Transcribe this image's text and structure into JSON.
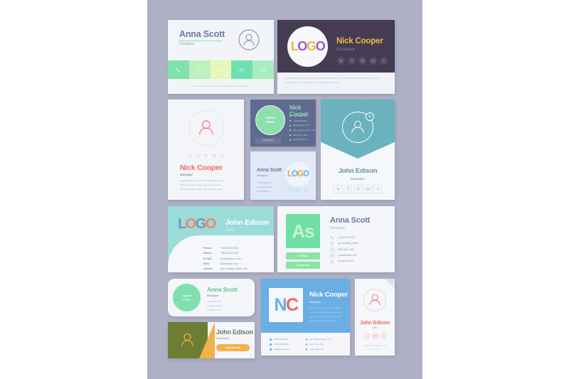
{
  "palette": {
    "canvas_bg": "#aeb0c6",
    "page_bg": "#ffffff",
    "green": "#7fe8ae",
    "mint": "#9bdcd8",
    "teal": "#67b0bd",
    "dark_purple": "#453c53",
    "amber": "#f0b942",
    "coral": "#f4685c",
    "blue": "#6aaee4",
    "olive": "#6d7d33",
    "orange": "#f3b14a",
    "slate": "#6d7a9c"
  },
  "cards": [
    {
      "id": "card-anna-scott-green-strip",
      "name": "Anna Scott",
      "role": "Designer",
      "icons": [
        "phone-icon",
        "location-icon",
        "globe-icon",
        "mail-icon",
        "home-icon"
      ],
      "footer_text": "Fermentum posuere urna nec tincidunt praesent semper feugiat.",
      "strip_colors": [
        "#7fe3ab",
        "#bdf0bf",
        "#e6f7b9",
        "#6fe0b0",
        "#a9ecc0"
      ]
    },
    {
      "id": "card-nick-cooper-dark-logo",
      "name": "Nick Cooper",
      "role": "CEO/WEB",
      "logo_text": "LOGO",
      "logo_colors": [
        "#f0b942",
        "#8a63c4",
        "#f0b942",
        "#8a63c4"
      ],
      "icons": [
        "phone-icon",
        "location-icon",
        "globe-icon",
        "mail-icon",
        "home-icon"
      ],
      "body_text": "In est ante in nibh mauris. At quis risus sed vulputate odio ut enim blandit volutpat. Fermentum et molestie ac feugiat sed lectus. Gravida arcu ac tortor dignissim convallis."
    },
    {
      "id": "card-nick-cooper-vertical",
      "name": "Nick Cooper",
      "role": "Manager",
      "icons": [
        "phone-icon",
        "location-icon",
        "globe-icon",
        "mail-icon",
        "home-icon"
      ],
      "body_text": "Magna etiam tempor orci eu lobortis elementum nibh. Fermentum posuere urna nec tincidunt praesent semper feugiat. Nec habitasse platea."
    },
    {
      "id": "card-nick-cooper-upload-photo",
      "name": "Nick Cooper",
      "photo_label_line1": "Upload",
      "photo_label_line2": "Photo",
      "button_label": "website.com",
      "contacts": [
        "+18 00 000 002",
        "+18 00 000 003",
        "nick@cooper.com",
        "apt, building, street, city",
        "New York, USA",
        "nickcooper.com"
      ]
    },
    {
      "id": "card-anna-scott-logo-blue",
      "name": "Anna Scott",
      "role": "Designer",
      "logo_text": "LOGO",
      "logo_colors": [
        "#f0a33e",
        "#6aaee4",
        "#f0a33e",
        "#6aaee4"
      ],
      "contacts": [
        "+18 00 000 002",
        "anna@scott.com",
        "annascott.com"
      ],
      "icons": [
        "phone-icon",
        "mail-icon",
        "home-icon"
      ]
    },
    {
      "id": "card-john-edison-teal",
      "name": "John Edison",
      "role": "Developer",
      "avatar_badge": "+",
      "icons": [
        "phone-icon",
        "location-icon",
        "globe-icon",
        "mail-icon",
        "home-icon"
      ]
    },
    {
      "id": "card-john-edison-logo-mint",
      "name": "John Edison",
      "role": "CEO",
      "logo_text": "LOGO",
      "logo_colors": [
        "#7f93b5",
        "#f4817a",
        "#7f93b5",
        "#f4817a"
      ],
      "details": [
        {
          "label": "Phone:",
          "value": "+58 00 000 002"
        },
        {
          "label": "Mobile:",
          "value": "+58 00 000 003"
        },
        {
          "label": "E-mail:",
          "value": "john@edison.com"
        },
        {
          "label": "Web:",
          "value": "johnedison.com"
        },
        {
          "label": "Adress:",
          "value": "apt, building, street, city"
        }
      ]
    },
    {
      "id": "card-anna-scott-monogram",
      "name": "Anna Scott",
      "role": "Designer",
      "monogram": "As",
      "buttons": [
        "Portfolio",
        "Contact me"
      ],
      "contacts": [
        {
          "icon": "phone-icon",
          "value": "+18 00 000 002"
        },
        {
          "icon": "location-icon",
          "value": "apt, building, street"
        },
        {
          "icon": "globe-icon",
          "value": "New York, USA"
        },
        {
          "icon": "mail-icon",
          "value": "anna@scott.com"
        },
        {
          "icon": "home-icon",
          "value": "annascott.com"
        }
      ]
    },
    {
      "id": "card-anna-scott-upload-pill",
      "name": "Anna Scott",
      "role": "Designer",
      "photo_label_line1": "Upload",
      "photo_label_line2": "Photo",
      "contacts": [
        "+18 00 000 002",
        "anna@scott.com",
        "annascott.com"
      ]
    },
    {
      "id": "card-john-edison-olive",
      "name": "John Edison",
      "role": "Developer",
      "button_label": "website.com"
    },
    {
      "id": "card-nick-cooper-monogram-blue",
      "name": "Nick Cooper",
      "role": "Manager",
      "monogram_first": "N",
      "monogram_second": "C",
      "monogram_colors": [
        "#6aaee4",
        "#f4685c"
      ],
      "body_text": "Magna etiam tempor orci eu lobortis elementum nibh. Fermentum posuere urna nec tincidunt praesent semper feugiat. Nec habitasse platea.",
      "contacts_left": [
        "+18 00 000 002",
        "+18 00 000 003",
        "nick@cooper.com"
      ],
      "contacts_right": [
        "apt, building, street, city",
        "New York, USA",
        "nickcooper.com"
      ]
    },
    {
      "id": "card-john-edison-vertical-fold",
      "name": "John Edison",
      "role": "CEO",
      "icons": [
        "phone-icon",
        "mail-icon",
        "home-icon"
      ],
      "footer_text": "Nullam risus suscipit ut enim condimentum."
    }
  ]
}
